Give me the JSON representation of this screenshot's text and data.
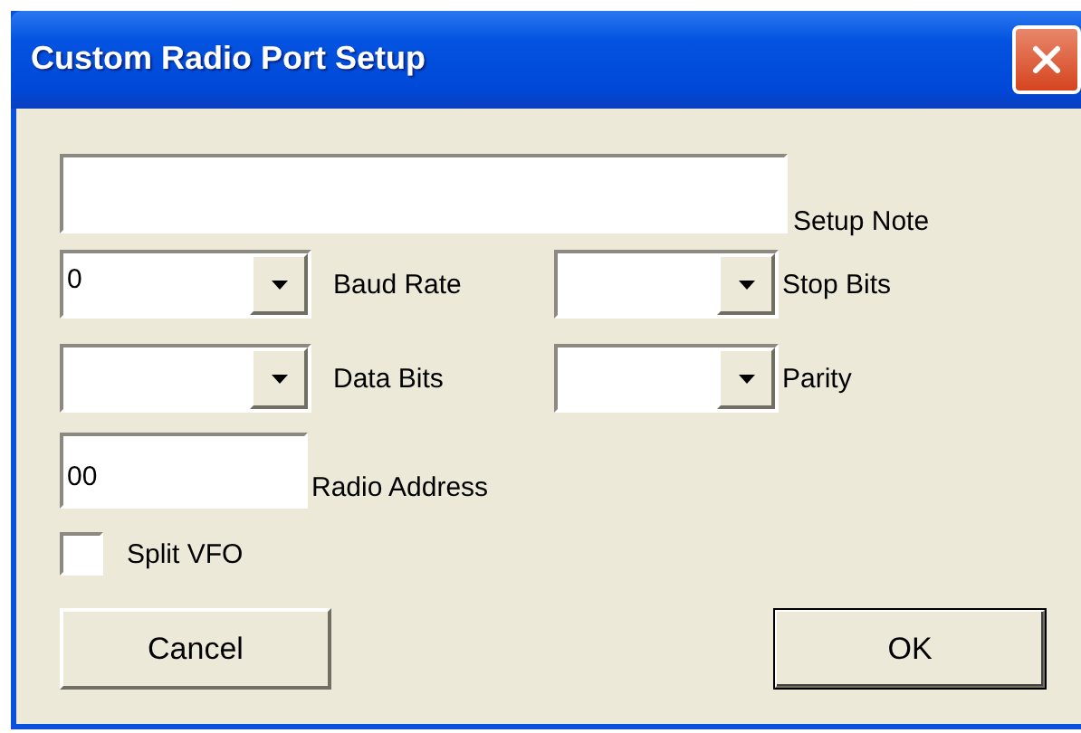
{
  "window": {
    "title": "Custom Radio Port Setup"
  },
  "setup_note": {
    "label": "Setup Note"
  },
  "baud_rate": {
    "value": "0",
    "label": "Baud Rate"
  },
  "stop_bits": {
    "label": "Stop Bits"
  },
  "data_bits": {
    "label": "Data Bits"
  },
  "parity": {
    "label": "Parity"
  },
  "radio_address": {
    "value": "00",
    "label": "Radio Address"
  },
  "split_vfo": {
    "label": "Split VFO",
    "checked": false
  },
  "buttons": [
    {
      "label": "Cancel",
      "default": false
    },
    {
      "label": "OK",
      "default": true
    }
  ]
}
